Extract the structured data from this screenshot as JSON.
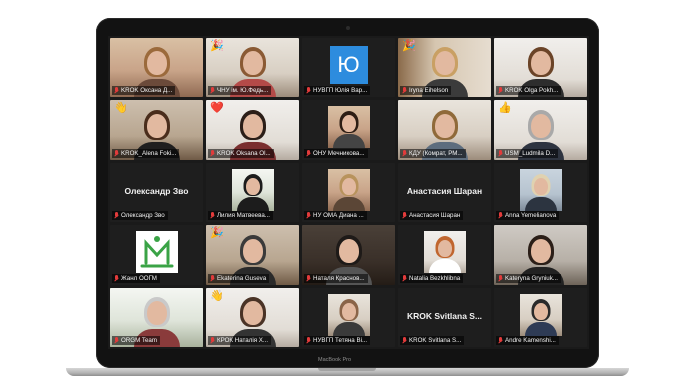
{
  "device": {
    "brand": "MacBook Pro"
  },
  "accent": {
    "active_speaker": "#c7e05a",
    "muted_mic": "#e23b3b",
    "avatar_blue": "#2d8cde"
  },
  "participants": [
    {
      "name": "KROK Оксана Д...",
      "type": "video",
      "bg": "bg-warm",
      "hair": "#9b6a3c",
      "shirt": "#6b4a3a"
    },
    {
      "name": "ЧНУ ім. Ю.Федь...",
      "type": "video",
      "bg": "bg-light",
      "hair": "#8a5a34",
      "shirt": "#b44a48",
      "reaction": "🎉"
    },
    {
      "name": "НУВГП Юлія Вар...",
      "type": "avatar",
      "letter": "Ю"
    },
    {
      "name": "Iryna Eihelson",
      "type": "video",
      "bg": "bg-shelf",
      "hair": "#c9a064",
      "shirt": "#3b3b3b",
      "reaction": "🎉"
    },
    {
      "name": "KROK Olga Pokh...",
      "type": "video",
      "bg": "bg-white",
      "hair": "#6b4428",
      "shirt": "#2d2d2d"
    },
    {
      "name": "KROK_Alena Foki...",
      "type": "video",
      "bg": "bg-room",
      "hair": "#4a2d1c",
      "shirt": "#1f1f1f",
      "reaction": "👋"
    },
    {
      "name": "KROK Oksana Ol...",
      "type": "video",
      "bg": "bg-white",
      "hair": "#2b1e18",
      "shirt": "#7a2f2f",
      "reaction": "❤️"
    },
    {
      "name": "ОНУ Мечникова...",
      "type": "mini",
      "bg": "bg-warm",
      "hair": "#2d1d14",
      "shirt": "#444"
    },
    {
      "name": "КДУ (Комрат, РМ...",
      "type": "video",
      "bg": "bg-light",
      "hair": "#8f6a3a",
      "shirt": "#5d6d7e"
    },
    {
      "name": "USM_Ludmila D...",
      "type": "video",
      "bg": "bg-white",
      "hair": "#a9a9a9",
      "shirt": "#2e3440",
      "reaction": "👍"
    },
    {
      "name": "Олександр Зво",
      "type": "name",
      "display": "Олександр Зво"
    },
    {
      "name": "Лилия Матвеева...",
      "type": "mini",
      "bg": "bg-snow",
      "hair": "#1c1c1c",
      "shirt": "#1c1c1c"
    },
    {
      "name": "НУ ОМА Диана ...",
      "type": "mini",
      "bg": "bg-warm",
      "hair": "#b8935c",
      "shirt": "#5b4636"
    },
    {
      "name": "Анастасия Шаран",
      "type": "name",
      "display": "Анастасия Шаран"
    },
    {
      "name": "Anna Yemelianova",
      "type": "mini",
      "bg": "bg-blue",
      "hair": "#e0d2b0",
      "shirt": "#2c3440"
    },
    {
      "name": "Жанл ООГМ",
      "type": "logo"
    },
    {
      "name": "Ekaterina Guseva",
      "type": "video",
      "bg": "bg-room",
      "hair": "#3a3a3a",
      "shirt": "#2a2a2a",
      "reaction": "🎉"
    },
    {
      "name": "Наталя Краснов...",
      "type": "video",
      "bg": "bg-darkroom",
      "hair": "#1e1a18",
      "shirt": "#555"
    },
    {
      "name": "Natalia Bezkhlibna",
      "type": "mini",
      "bg": "bg-white",
      "hair": "#c0662f",
      "shirt": "#ffffff"
    },
    {
      "name": "Kateryna Gryniuk...",
      "type": "video",
      "bg": "bg-tree",
      "hair": "#2b1f18",
      "shirt": "#222"
    },
    {
      "name": "ORGM Team",
      "type": "video",
      "bg": "bg-snow",
      "hair": "#c9c9c9",
      "shirt": "#8a3b3b",
      "active": true
    },
    {
      "name": "КРОК Наталія Х...",
      "type": "video",
      "bg": "bg-white",
      "hair": "#4a3326",
      "shirt": "#333",
      "reaction": "👋"
    },
    {
      "name": "НУВГП Тетяна Ві...",
      "type": "mini",
      "bg": "bg-light",
      "hair": "#8a6448",
      "shirt": "#3a3a3a"
    },
    {
      "name": "KROK Svitlana S...",
      "type": "name",
      "display": "KROK Svitlana S..."
    },
    {
      "name": "Andre Kamenshi...",
      "type": "mini",
      "bg": "bg-light",
      "hair": "#2a2a2a",
      "shirt": "#2e3b55"
    }
  ]
}
